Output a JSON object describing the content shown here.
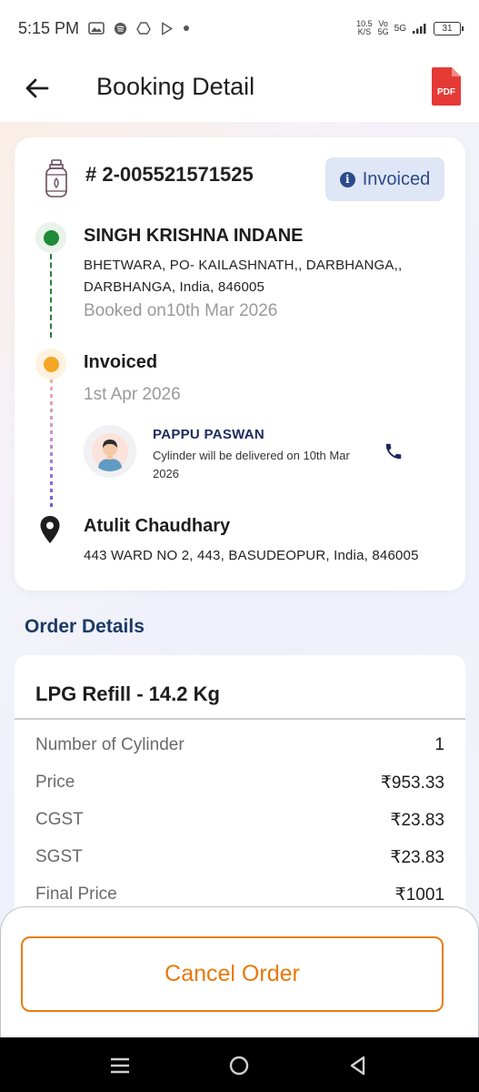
{
  "status_bar": {
    "time": "5:15 PM",
    "net_speed_value": "10.5",
    "net_speed_unit": "K/S",
    "volte": "Vo",
    "network": "5G",
    "battery": "31"
  },
  "header": {
    "title": "Booking Detail",
    "pdf_label": "PDF"
  },
  "booking": {
    "number": "# 2-005521571525",
    "status": "Invoiced"
  },
  "timeline": {
    "distributor": {
      "name": "SINGH KRISHNA INDANE",
      "address": "BHETWARA, PO- KAILASHNATH,, DARBHANGA,, DARBHANGA, India, 846005",
      "booked_text": "Booked on10th Mar 2026"
    },
    "invoice": {
      "title": "Invoiced",
      "date": "1st Apr 2026"
    },
    "delivery_agent": {
      "name": "PAPPU PASWAN",
      "message": "Cylinder will be delivered on 10th Mar 2026"
    },
    "customer": {
      "name": "Atulit Chaudhary",
      "address": "443 WARD NO 2, 443, BASUDEOPUR, India, 846005"
    }
  },
  "order": {
    "heading": "Order Details",
    "product": "LPG Refill - 14.2 Kg",
    "rows": [
      {
        "label": "Number of Cylinder",
        "value": "1"
      },
      {
        "label": "Price",
        "value": "₹953.33"
      },
      {
        "label": "CGST",
        "value": "₹23.83"
      },
      {
        "label": "SGST",
        "value": "₹23.83"
      },
      {
        "label": "Final Price",
        "value": "₹1001"
      }
    ]
  },
  "actions": {
    "cancel_label": "Cancel Order"
  },
  "colors": {
    "accent_orange": "#e8790a",
    "chip_bg": "#dfe6f5",
    "chip_text": "#2b4a8c",
    "green_dot": "#1f8a3a",
    "orange_dot": "#f5a623",
    "heading_blue": "#1b3a66",
    "pdf_red": "#e53935"
  }
}
